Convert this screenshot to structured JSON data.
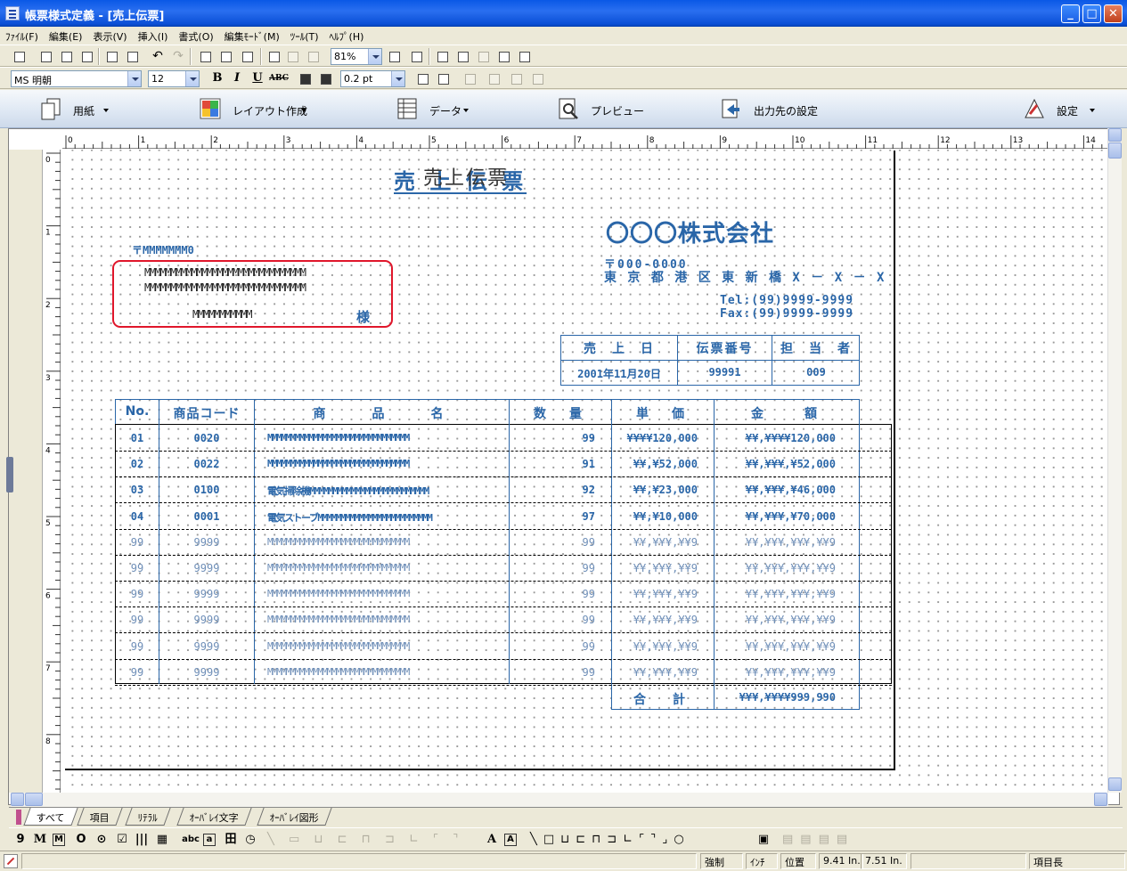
{
  "window": {
    "title": "帳票様式定義 - [売上伝票]"
  },
  "menu": [
    "ﾌｧｲﾙ(F)",
    "編集(E)",
    "表示(V)",
    "挿入(I)",
    "書式(O)",
    "編集ﾓｰﾄﾞ(M)",
    "ﾂｰﾙ(T)",
    "ﾍﾙﾌﾟ(H)"
  ],
  "toolbar": {
    "zoom": "81%",
    "font": "MS 明朝",
    "font_size": "12",
    "line_width": "0.2 pt",
    "bold": "B",
    "italic": "I",
    "underline": "U",
    "abc": "ABC"
  },
  "ribbon": [
    {
      "label": "用紙",
      "icon": "paper-icon",
      "dropdown": true
    },
    {
      "label": "レイアウト作成",
      "icon": "layout-icon",
      "dropdown": true
    },
    {
      "label": "データ",
      "icon": "data-icon",
      "dropdown": true
    },
    {
      "label": "プレビュー",
      "icon": "preview-icon",
      "dropdown": false
    },
    {
      "label": "出力先の設定",
      "icon": "output-icon",
      "dropdown": false
    },
    {
      "label": "設定",
      "icon": "settings-icon",
      "dropdown": true
    }
  ],
  "ruler": {
    "h": [
      "0",
      "1",
      "2",
      "3",
      "4",
      "5",
      "6",
      "7",
      "8",
      "9",
      "10",
      "11",
      "12",
      "13",
      "14"
    ],
    "v": [
      "0",
      "1",
      "2",
      "3",
      "4",
      "5",
      "6",
      "7",
      "8"
    ]
  },
  "form": {
    "title": "売 上 伝 票",
    "title_overlay": "売上伝票",
    "postal_mark": "〒MMMMMMM0",
    "customer_line1": "MMMMMMMMMMMMMMMMMMMMMMMMMMMMMMM",
    "customer_line2": "MMMMMMMMMMMMMMMMMMMMMMMMMMMMMMM",
    "customer_name": "MMMMMMMMMMM",
    "honorific": "様",
    "company": "〇〇〇株式会社",
    "company_postal": "〒000-0000",
    "company_address": "東 京 都 港 区 東 新 橋 X － X － X",
    "tel": "Tel:(99)9999-9999",
    "fax": "Fax:(99)9999-9999",
    "info_headers": [
      "売　上　日",
      "伝票番号",
      "担　当　者"
    ],
    "info_values": [
      "2001年11月20日",
      "99991",
      "009"
    ],
    "table_headers": [
      "No.",
      "商品コード",
      "商　　品　　名",
      "数　量",
      "単　価",
      "金　　額"
    ],
    "rows": [
      {
        "no": "01",
        "code": "0020",
        "name": "MMMMMMMMMMMMMMMMMMMMMMMMMMMMMMM",
        "qty": "99",
        "price": "¥¥¥¥120,000",
        "amount": "¥¥,¥¥¥¥120,000",
        "dim": false
      },
      {
        "no": "02",
        "code": "0022",
        "name": "MMMMMMMMMMMMMMMMMMMMMMMMMMMMMMM",
        "qty": "91",
        "price": "¥¥,¥52,000",
        "amount": "¥¥,¥¥¥,¥52,000",
        "dim": false
      },
      {
        "no": "03",
        "code": "0100",
        "name": "電気掃除機MMMMMMMMMMMMMMMMMMMMMMMMMM",
        "qty": "92",
        "price": "¥¥,¥23,000",
        "amount": "¥¥,¥¥¥,¥46,000",
        "dim": false
      },
      {
        "no": "04",
        "code": "0001",
        "name": "電気ストーブMMMMMMMMMMMMMMMMMMMMMMMMM",
        "qty": "97",
        "price": "¥¥,¥10,000",
        "amount": "¥¥,¥¥¥,¥70,000",
        "dim": false
      },
      {
        "no": "99",
        "code": "9999",
        "name": "MMMMMMMMMMMMMMMMMMMMMMMMMMMMMMM",
        "qty": "99",
        "price": "¥¥,¥¥¥,¥¥9",
        "amount": "¥¥,¥¥¥,¥¥¥,¥¥9",
        "dim": true
      },
      {
        "no": "99",
        "code": "9999",
        "name": "MMMMMMMMMMMMMMMMMMMMMMMMMMMMMMM",
        "qty": "99",
        "price": "¥¥,¥¥¥,¥¥9",
        "amount": "¥¥,¥¥¥,¥¥¥,¥¥9",
        "dim": true
      },
      {
        "no": "99",
        "code": "9999",
        "name": "MMMMMMMMMMMMMMMMMMMMMMMMMMMMMMM",
        "qty": "99",
        "price": "¥¥,¥¥¥,¥¥9",
        "amount": "¥¥,¥¥¥,¥¥¥,¥¥9",
        "dim": true
      },
      {
        "no": "99",
        "code": "9999",
        "name": "MMMMMMMMMMMMMMMMMMMMMMMMMMMMMMM",
        "qty": "99",
        "price": "¥¥,¥¥¥,¥¥9",
        "amount": "¥¥,¥¥¥,¥¥¥,¥¥9",
        "dim": true
      },
      {
        "no": "99",
        "code": "9999",
        "name": "MMMMMMMMMMMMMMMMMMMMMMMMMMMMMMM",
        "qty": "99",
        "price": "¥¥,¥¥¥,¥¥9",
        "amount": "¥¥,¥¥¥,¥¥¥,¥¥9",
        "dim": true
      },
      {
        "no": "99",
        "code": "9999",
        "name": "MMMMMMMMMMMMMMMMMMMMMMMMMMMMMMM",
        "qty": "99",
        "price": "¥¥,¥¥¥,¥¥9",
        "amount": "¥¥,¥¥¥,¥¥¥,¥¥9",
        "dim": true
      }
    ],
    "total_label": "合　計",
    "total_value": "¥¥¥,¥¥¥¥999,990"
  },
  "tabs": [
    "すべて",
    "項目",
    "ﾘﾃﾗﾙ",
    "ｵｰﾊﾞﾚｲ文字",
    "ｵｰﾊﾞﾚｲ図形"
  ],
  "toolbox": [
    "9",
    "M",
    "M",
    "O",
    "⊙",
    "☑",
    "|||",
    "▦",
    "abc",
    "a",
    "田",
    "◷",
    "A",
    "A"
  ],
  "status": {
    "mode": "強制",
    "unit": "ｲﾝﾁ",
    "pos_label": "位置",
    "pos_x": "9.41 In.",
    "pos_y": "7.51 In.",
    "field": "項目長"
  }
}
